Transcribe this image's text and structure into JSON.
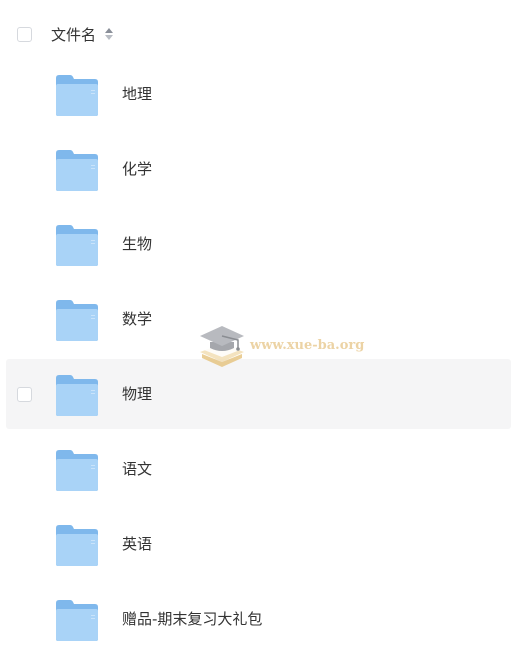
{
  "header": {
    "column_title": "文件名",
    "sort_icon": "sort-up-down-icon"
  },
  "files": [
    {
      "name": "地理",
      "icon": "folder-icon"
    },
    {
      "name": "化学",
      "icon": "folder-icon"
    },
    {
      "name": "生物",
      "icon": "folder-icon"
    },
    {
      "name": "数学",
      "icon": "folder-icon"
    },
    {
      "name": "物理",
      "icon": "folder-icon",
      "hovered": true
    },
    {
      "name": "语文",
      "icon": "folder-icon"
    },
    {
      "name": "英语",
      "icon": "folder-icon"
    },
    {
      "name": "赠品-期末复习大礼包",
      "icon": "folder-icon"
    }
  ],
  "watermark": {
    "text": "www.xue-ba.org",
    "icon": "graduation-cap-icon"
  },
  "colors": {
    "folder_back": "#7fb8ec",
    "folder_front": "#a9d3f7",
    "hover_row": "#f5f5f6",
    "watermark_text": "#e8c98f"
  }
}
